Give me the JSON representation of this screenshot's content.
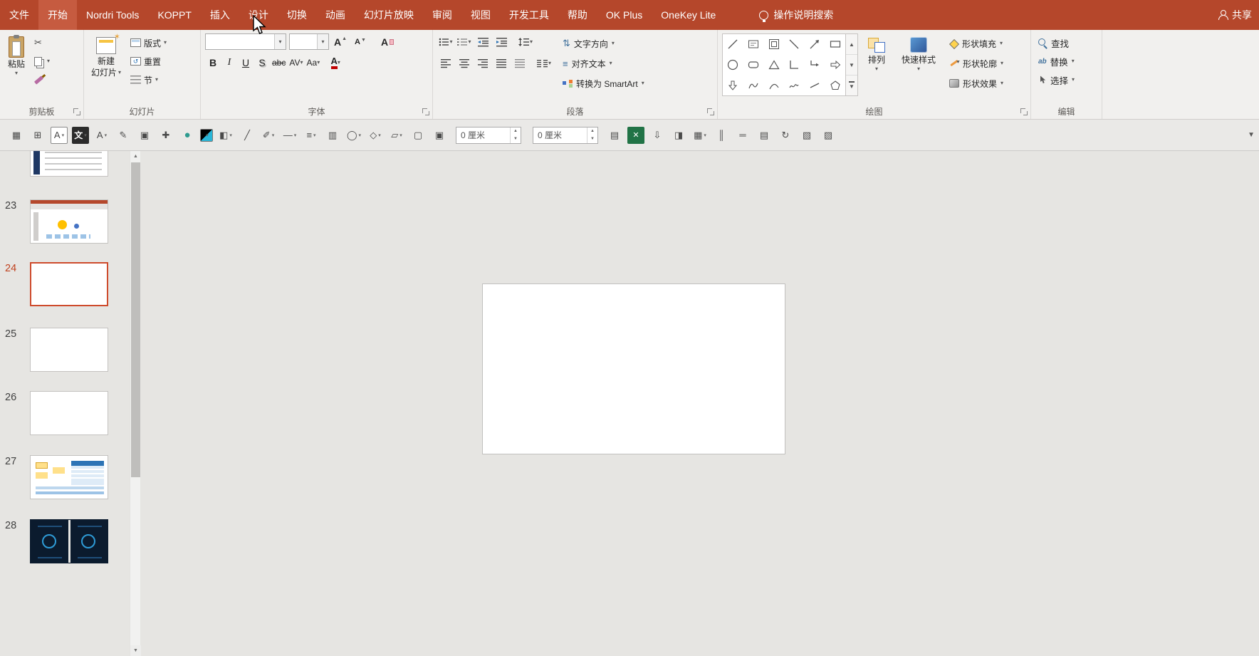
{
  "menu": {
    "items": [
      "文件",
      "开始",
      "Nordri Tools",
      "KOPPT",
      "插入",
      "设计",
      "切换",
      "动画",
      "幻灯片放映",
      "审阅",
      "视图",
      "开发工具",
      "帮助",
      "OK Plus",
      "OneKey Lite"
    ],
    "active_tab": "开始",
    "search_label": "操作说明搜索",
    "share_label": "共享"
  },
  "ribbon": {
    "clipboard": {
      "group_label": "剪贴板",
      "paste": "粘贴"
    },
    "slides": {
      "group_label": "幻灯片",
      "new_slide_line1": "新建",
      "new_slide_line2": "幻灯片",
      "layout": "版式",
      "reset": "重置",
      "section": "节"
    },
    "font": {
      "group_label": "字体",
      "font_name_value": "",
      "font_size_value": "",
      "bold": "B",
      "italic": "I",
      "underline": "U",
      "shadow": "S",
      "strike": "abc",
      "spacing": "AV",
      "case": "Aa",
      "color": "A"
    },
    "paragraph": {
      "group_label": "段落",
      "text_direction": "文字方向",
      "align_text": "对齐文本",
      "smartart": "转换为 SmartArt"
    },
    "drawing": {
      "group_label": "绘图",
      "arrange": "排列",
      "quick_styles": "快速样式",
      "shape_fill": "形状填充",
      "shape_outline": "形状轮廓",
      "shape_effects": "形状效果"
    },
    "editing": {
      "group_label": "编辑",
      "find": "查找",
      "replace": "替换",
      "select": "选择"
    }
  },
  "toolbar2": {
    "spinner1_value": "0 厘米",
    "spinner2_value": "0 厘米",
    "items_left": [
      {
        "n": "table-grid-icon",
        "g": "▦"
      },
      {
        "n": "layout-grid-icon",
        "g": "⊞"
      },
      {
        "n": "textbox-tool-icon",
        "g": "A",
        "cls": "box",
        "dd": true
      },
      {
        "n": "text-style-icon",
        "g": "文",
        "cls": "dark",
        "dd": true
      },
      {
        "n": "font-tool-icon",
        "g": "A",
        "dd": true
      },
      {
        "n": "eyedropper-icon",
        "g": "✎"
      },
      {
        "n": "picture-tool-icon",
        "g": "▣"
      },
      {
        "n": "pin-icon",
        "g": "✚"
      },
      {
        "n": "color-circle-icon",
        "g": "●",
        "cls": "teal"
      },
      {
        "n": "color-swatch-icon",
        "cls": "swatch",
        "dd": true
      },
      {
        "n": "fill-bucket-icon",
        "g": "◧",
        "dd": true
      },
      {
        "n": "pipette-icon",
        "g": "╱"
      },
      {
        "n": "pen-tool-icon",
        "g": "✐",
        "dd": true
      },
      {
        "n": "line-tool-icon",
        "g": "—",
        "dd": true
      },
      {
        "n": "align-tool-icon",
        "g": "≡",
        "dd": true
      },
      {
        "n": "chart-tool-icon",
        "g": "▥"
      },
      {
        "n": "oval-tool-icon",
        "g": "◯",
        "dd": true
      },
      {
        "n": "shape-tool-icon",
        "g": "◇",
        "dd": true
      },
      {
        "n": "skew-tool-icon",
        "g": "▱",
        "dd": true
      },
      {
        "n": "crop-tool-icon",
        "g": "▢"
      },
      {
        "n": "mask-tool-icon",
        "g": "▣"
      }
    ],
    "items_right": [
      {
        "n": "keyboard-icon",
        "g": "▤"
      },
      {
        "n": "delete-x-icon",
        "g": "✕",
        "cls": "green"
      },
      {
        "n": "export-icon",
        "g": "⇩"
      },
      {
        "n": "format-paint-icon",
        "g": "◨"
      },
      {
        "n": "border-style-icon",
        "g": "▦",
        "dd": true
      },
      {
        "n": "distribute-h-icon",
        "g": "║"
      },
      {
        "n": "distribute-v-icon",
        "g": "═"
      },
      {
        "n": "align-objects-icon",
        "g": "▤"
      },
      {
        "n": "rotate-tool-icon",
        "g": "↻"
      },
      {
        "n": "group-tool-icon",
        "g": "▧"
      },
      {
        "n": "size-tool-icon",
        "g": "▨"
      }
    ]
  },
  "slides": {
    "items": [
      {
        "number": ""
      },
      {
        "number": "23"
      },
      {
        "number": "24",
        "selected": true
      },
      {
        "number": "25"
      },
      {
        "number": "26"
      },
      {
        "number": "27"
      },
      {
        "number": "28"
      }
    ]
  }
}
